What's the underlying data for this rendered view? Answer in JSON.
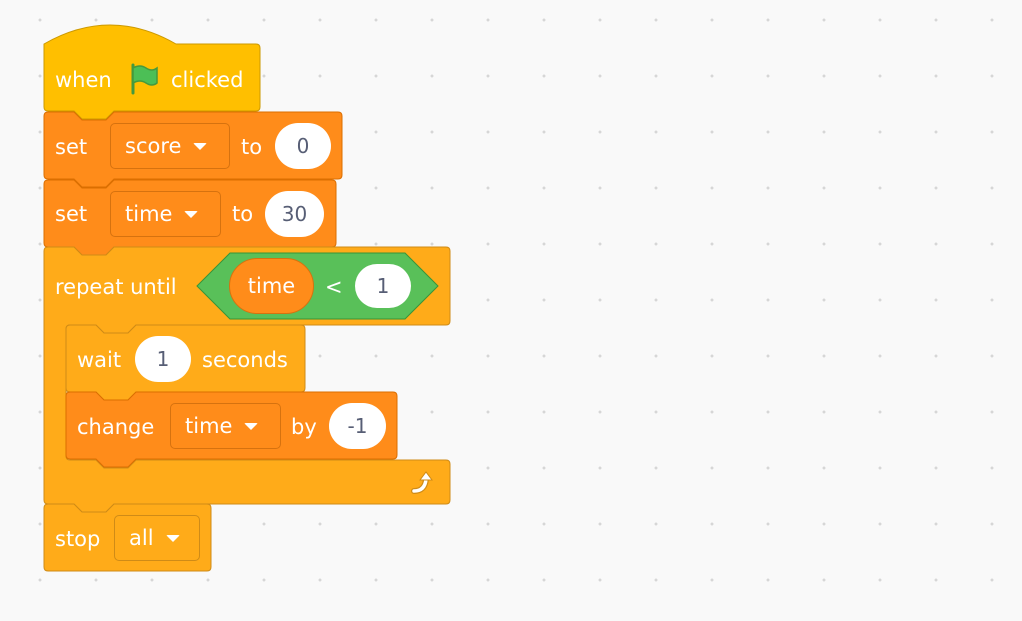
{
  "colors": {
    "events": "#ffbf00",
    "variables": "#ff8c1a",
    "control": "#ffab19",
    "operators": "#59c059",
    "flag_green": "#4cbf56"
  },
  "script": {
    "hat_block": {
      "when": "when",
      "icon": "green-flag-icon",
      "clicked": "clicked"
    },
    "set_score": {
      "keyword": "set",
      "variable": "score",
      "to": "to",
      "value": "0"
    },
    "set_time": {
      "keyword": "set",
      "variable": "time",
      "to": "to",
      "value": "30"
    },
    "repeat_until": {
      "label": "repeat until",
      "condition": {
        "left_variable": "time",
        "operator": "<",
        "right_value": "1"
      },
      "loop_icon": "repeat-arrow-icon",
      "body": {
        "wait": {
          "keyword": "wait",
          "value": "1",
          "suffix": "seconds"
        },
        "change": {
          "keyword": "change",
          "variable": "time",
          "by": "by",
          "value": "-1"
        }
      }
    },
    "stop": {
      "keyword": "stop",
      "option": "all"
    }
  }
}
